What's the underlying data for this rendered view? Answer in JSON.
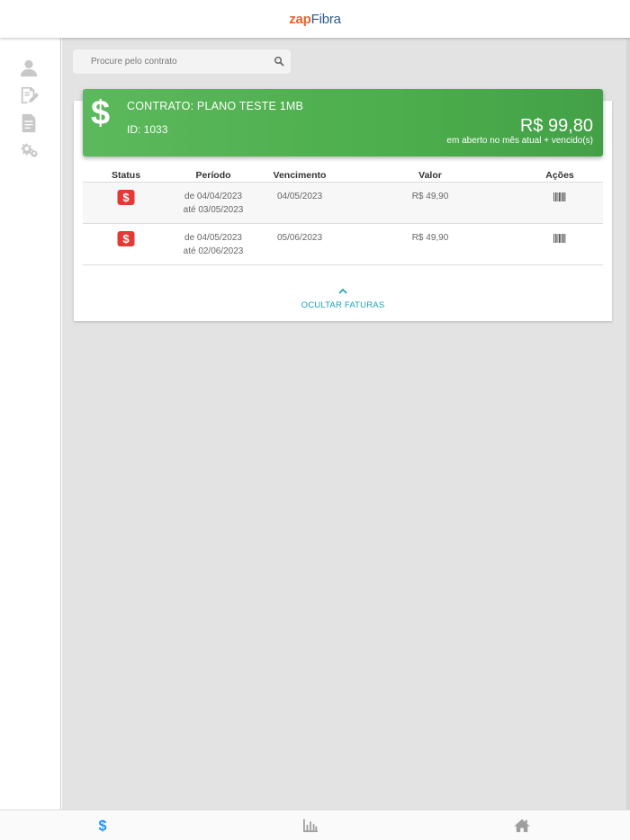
{
  "header": {
    "logo_part1": "zap",
    "logo_part2": "Fibra"
  },
  "sidebar": {
    "items": [
      {
        "name": "user-icon"
      },
      {
        "name": "edit-document-icon"
      },
      {
        "name": "document-icon"
      },
      {
        "name": "settings-gears-icon"
      }
    ]
  },
  "search": {
    "placeholder": "Procure pelo contrato"
  },
  "contract": {
    "title": "CONTRATO: PLANO TESTE 1MB",
    "id": "ID: 1033",
    "amount": "R$ 99,80",
    "amount_note": "em aberto no mês atual + vencido(s)",
    "icon": "$"
  },
  "table": {
    "headers": [
      "Status",
      "Período",
      "Vencimento",
      "Valor",
      "Ações"
    ],
    "rows": [
      {
        "status_icon": "$",
        "period_from": "de 04/04/2023",
        "period_to": "até 03/05/2023",
        "due": "04/05/2023",
        "value": "R$ 49,90"
      },
      {
        "status_icon": "$",
        "period_from": "de 04/05/2023",
        "period_to": "até 02/06/2023",
        "due": "05/06/2023",
        "value": "R$ 49,90"
      }
    ]
  },
  "toggle": {
    "label": "OCULTAR FATURAS"
  },
  "bottom_nav": {
    "items": [
      {
        "name": "dollar-icon",
        "color": "#2196f3",
        "active": true
      },
      {
        "name": "bar-chart-icon",
        "color": "#9e9e9e",
        "active": false
      },
      {
        "name": "home-icon",
        "color": "#9e9e9e",
        "active": false
      }
    ]
  },
  "colors": {
    "accent_green": "#4cae4c",
    "status_red": "#e53935",
    "link_teal": "#17a2b8",
    "active_blue": "#2196f3"
  }
}
